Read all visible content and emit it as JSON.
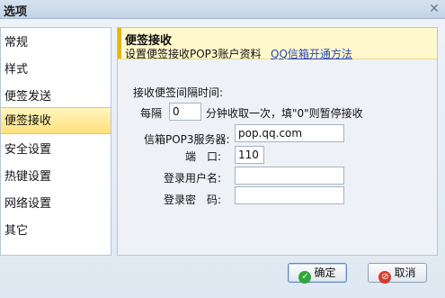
{
  "window": {
    "title": "选项",
    "close_glyph": "✕"
  },
  "sidebar": {
    "items": [
      {
        "label": "常规"
      },
      {
        "label": "样式"
      },
      {
        "label": "便签发送"
      },
      {
        "label": "便签接收",
        "active": true
      },
      {
        "label": "安全设置"
      },
      {
        "label": "热键设置"
      },
      {
        "label": "网络设置"
      },
      {
        "label": "其它"
      }
    ]
  },
  "panel": {
    "title": "便签接收",
    "description": "设置便签接收POP3账户资料",
    "help_link": "QQ信箱开通方法",
    "interval_heading": "接收便签间隔时间:",
    "interval_prefix": "每隔",
    "interval_value": "0",
    "interval_suffix": "分钟收取一次，填\"0\"则暂停接收",
    "pop3_label": "信箱POP3服务器:",
    "pop3_value": "pop.qq.com",
    "port_label": "端　口:",
    "port_value": "110",
    "username_label": "登录用户名:",
    "username_value": "",
    "password_label": "登录密　码:",
    "password_value": ""
  },
  "footer": {
    "ok_label": "确定",
    "cancel_label": "取消"
  },
  "colors": {
    "accent_bar": "#e2b719",
    "selected_item": "#ffe07a",
    "link": "#2a46b8"
  }
}
